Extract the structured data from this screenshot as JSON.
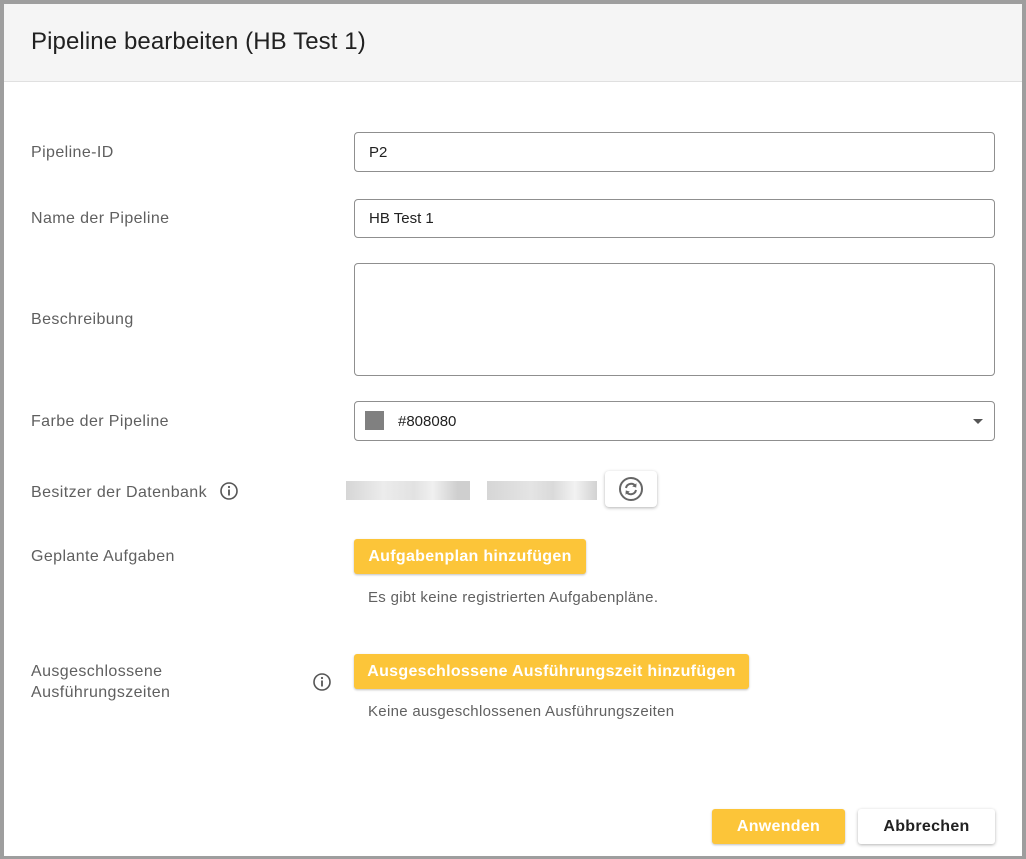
{
  "dialog": {
    "title": "Pipeline bearbeiten (HB Test 1)"
  },
  "form": {
    "pipeline_id": {
      "label": "Pipeline-ID",
      "value": "P2"
    },
    "name": {
      "label": "Name der Pipeline",
      "value": "HB Test 1"
    },
    "description": {
      "label": "Beschreibung",
      "value": ""
    },
    "color": {
      "label": "Farbe der Pipeline",
      "value": "#808080",
      "swatch": "#808080"
    },
    "owner": {
      "label": "Besitzer der Datenbank",
      "info_icon": "info-icon",
      "refresh_icon": "refresh-icon"
    },
    "scheduled": {
      "label": "Geplante Aufgaben",
      "add_button": "Aufgabenplan hinzufügen",
      "empty_text": "Es gibt keine registrierten Aufgabenpläne."
    },
    "excluded": {
      "label_line1": "Ausgeschlossene",
      "label_line2": "Ausführungszeiten",
      "info_icon": "info-icon",
      "add_button": "Ausgeschlossene Ausführungszeit hinzufügen",
      "empty_text": "Keine ausgeschlossenen Ausführungszeiten"
    }
  },
  "footer": {
    "apply_button": "Anwenden",
    "cancel_button": "Abbrechen"
  },
  "colors": {
    "accent": "#fcc539",
    "header_bg": "#f5f5f5",
    "border": "#9e9e9e"
  }
}
